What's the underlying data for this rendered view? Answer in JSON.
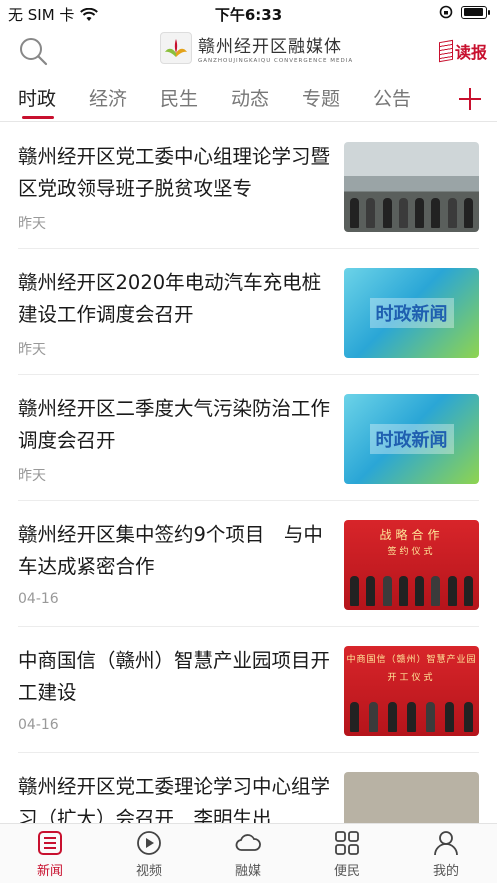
{
  "status_bar": {
    "carrier": "无 SIM 卡",
    "time": "下午6:33",
    "battery_level": 0.95
  },
  "header": {
    "logo_title": "赣州经开区融媒体",
    "logo_subtitle": "GANZHOUJINGKAIQU CONVERGENCE MEDIA",
    "read_label": "读报"
  },
  "tabs": [
    {
      "label": "时政",
      "active": true
    },
    {
      "label": "经济"
    },
    {
      "label": "民生"
    },
    {
      "label": "动态"
    },
    {
      "label": "专题"
    },
    {
      "label": "公告"
    }
  ],
  "articles": [
    {
      "title": "赣州经开区党工委中心组理论学习暨区党政领导班子脱贫攻坚专",
      "date": "昨天",
      "thumb": "meeting-photo"
    },
    {
      "title": "赣州经开区2020年电动汽车充电桩建设工作调度会召开",
      "date": "昨天",
      "thumb": "news-banner",
      "thumb_text": "时政新闻"
    },
    {
      "title": "赣州经开区二季度大气污染防治工作调度会召开",
      "date": "昨天",
      "thumb": "news-banner",
      "thumb_text": "时政新闻"
    },
    {
      "title": "赣州经开区集中签约9个项目　与中车达成紧密合作",
      "date": "04-16",
      "thumb": "signing-photo",
      "thumb_text": "战略合作",
      "thumb_subtext": "签约仪式"
    },
    {
      "title": "中商国信（赣州）智慧产业园项目开工建设",
      "date": "04-16",
      "thumb": "ceremony-photo",
      "thumb_text": "中商国信（赣州）智慧产业园",
      "thumb_subtext": "开工仪式"
    },
    {
      "title": "赣州经开区党工委理论学习中心组学习（扩大）会召开　李明生出",
      "date": "",
      "thumb": "hall-photo"
    }
  ],
  "tabbar": [
    {
      "label": "新闻",
      "icon": "list-icon",
      "active": true
    },
    {
      "label": "视频",
      "icon": "play-icon"
    },
    {
      "label": "融媒",
      "icon": "cloud-icon"
    },
    {
      "label": "便民",
      "icon": "grid-icon"
    },
    {
      "label": "我的",
      "icon": "user-icon"
    }
  ],
  "colors": {
    "accent": "#c8102e",
    "text": "#1a1a1a",
    "muted": "#999999"
  }
}
